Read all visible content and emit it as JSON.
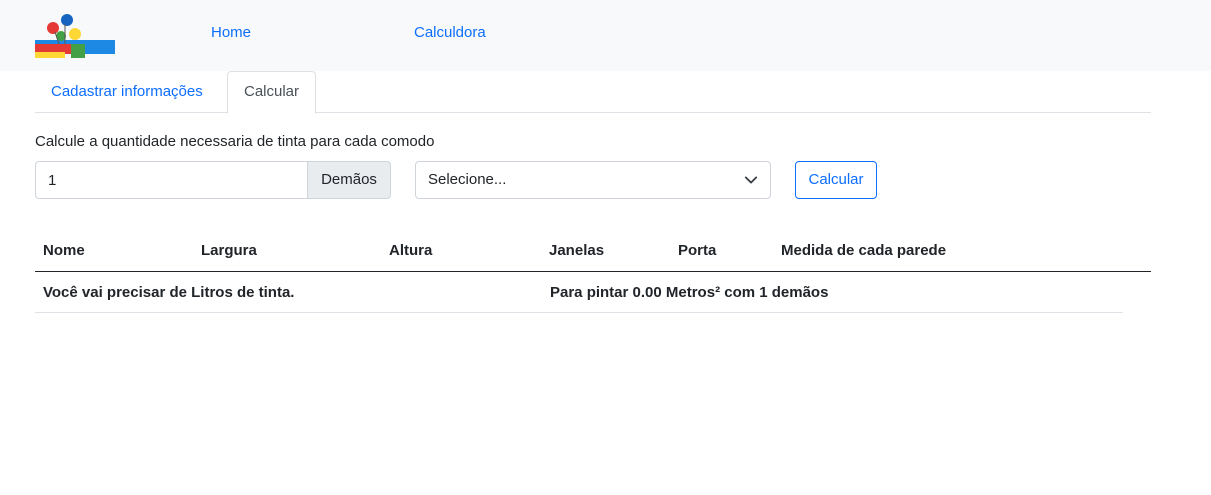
{
  "nav": {
    "home": "Home",
    "calculator": "Calculdora"
  },
  "tabs": [
    {
      "label": "Cadastrar informações",
      "active": false
    },
    {
      "label": "Calcular",
      "active": true
    }
  ],
  "form": {
    "description": "Calcule a quantidade necessaria de tinta para cada comodo",
    "coats_value": "1",
    "coats_addon": "Demãos",
    "select_placeholder": "Selecione...",
    "calculate_button": "Calcular"
  },
  "table": {
    "headers": [
      "Nome",
      "Largura",
      "Altura",
      "Janelas",
      "Porta",
      "Medida de cada parede"
    ],
    "footer_left": "Você vai precisar de Litros de tinta.",
    "footer_right": "Para pintar 0.00 Metros² com 1 demãos"
  },
  "colors": {
    "link": "#0d6efd",
    "navbar_bg": "#f8f9fa",
    "addon_bg": "#e9ecef"
  }
}
